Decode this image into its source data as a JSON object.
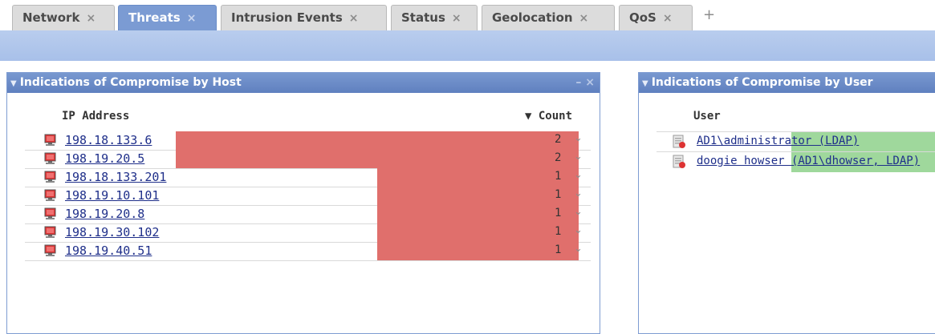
{
  "tabs": [
    {
      "label": "Network",
      "active": false
    },
    {
      "label": "Threats",
      "active": true
    },
    {
      "label": "Intrusion Events",
      "active": false
    },
    {
      "label": "Status",
      "active": false
    },
    {
      "label": "Geolocation",
      "active": false
    },
    {
      "label": "QoS",
      "active": false
    }
  ],
  "tab_close_glyph": "×",
  "add_tab_glyph": "+",
  "host_widget": {
    "title": "Indications of Compromise by Host",
    "controls": "– ×",
    "col_ip": "IP Address",
    "col_count": "▼ Count",
    "rows": [
      {
        "ip": "198.18.133.6",
        "count": 2
      },
      {
        "ip": "198.19.20.5",
        "count": 2
      },
      {
        "ip": "198.18.133.201",
        "count": 1
      },
      {
        "ip": "198.19.10.101",
        "count": 1
      },
      {
        "ip": "198.19.20.8",
        "count": 1
      },
      {
        "ip": "198.19.30.102",
        "count": 1
      },
      {
        "ip": "198.19.40.51",
        "count": 1
      }
    ],
    "bar_color": "#e06f6c"
  },
  "user_widget": {
    "title": "Indications of Compromise by User",
    "col_user": "User",
    "rows": [
      {
        "user": "AD1\\administrator (LDAP)"
      },
      {
        "user": "doogie howser (AD1\\dhowser, LDAP)"
      }
    ],
    "bar_color": "#9fd89c"
  },
  "colors": {
    "active_tab": "#7b9bd3",
    "header_blue": "#6a8bc8"
  },
  "icons": {
    "host": "host-computer-icon",
    "user": "user-card-icon",
    "dropdown": "chevron-down-icon"
  }
}
